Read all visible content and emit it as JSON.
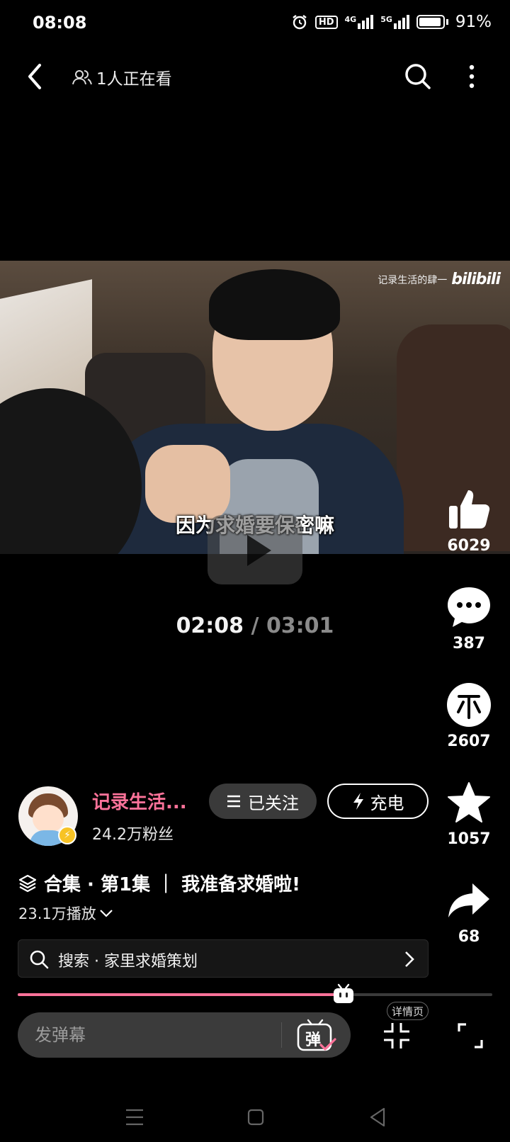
{
  "status_bar": {
    "time": "08:08",
    "hd_label": "HD",
    "net1": "4G",
    "net2": "5G",
    "battery_pct": "91%"
  },
  "top_nav": {
    "viewers_text": "1人正在看"
  },
  "video": {
    "watermark_text": "记录生活的肆一",
    "watermark_logo": "bilibili",
    "subtitle": "因为求婚要保密嘛"
  },
  "time": {
    "current": "02:08",
    "separator": "/",
    "total": "03:01"
  },
  "actions": {
    "like_count": "6029",
    "comment_count": "387",
    "coin_count": "2607",
    "fav_count": "1057",
    "share_count": "68"
  },
  "uploader": {
    "name": "记录生活...",
    "fans": "24.2万粉丝",
    "follow_label": "已关注",
    "charge_label": "充电"
  },
  "collection": {
    "title": "合集 · 第1集 ｜ 我准备求婚啦!",
    "plays": "23.1万播放"
  },
  "search": {
    "text": "搜索 · 家里求婚策划"
  },
  "progress": {
    "fraction": 0.686
  },
  "danmaku": {
    "placeholder": "发弹幕",
    "toggle_label": "弹"
  },
  "detail_tag": "详情页",
  "colors": {
    "accent_pink": "#fb7299",
    "bg": "#000000"
  }
}
